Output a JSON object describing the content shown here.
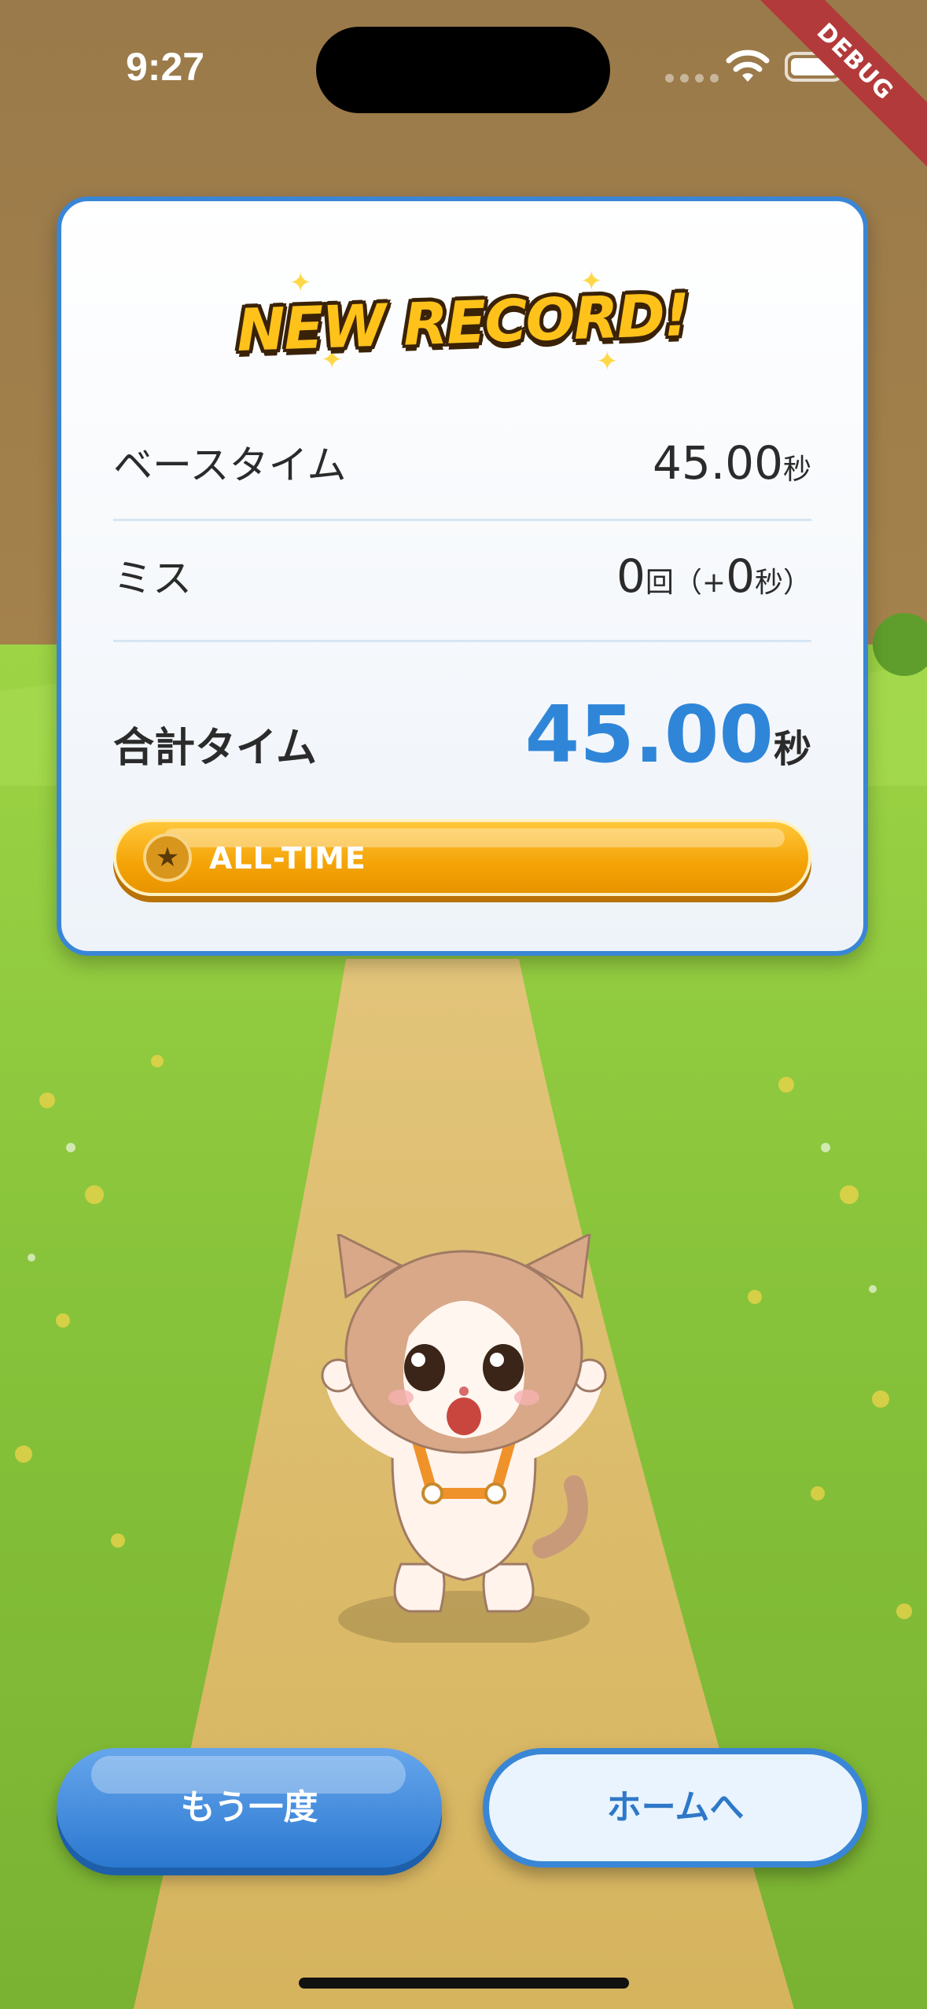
{
  "status_bar": {
    "time": "9:27"
  },
  "debug_banner": "DEBUG",
  "result_card": {
    "badge": "NEW RECORD!",
    "base_time": {
      "label": "ベースタイム",
      "value": "45.00",
      "unit": "秒"
    },
    "miss": {
      "label": "ミス",
      "count": "0",
      "count_unit": "回",
      "penalty_prefix": "（+",
      "penalty_value": "0",
      "penalty_suffix": "秒）"
    },
    "total_time": {
      "label": "合計タイム",
      "value": "45.00",
      "unit": "秒"
    },
    "rank_banner": {
      "label": "ALL-TIME",
      "icon": "star-icon"
    }
  },
  "buttons": {
    "retry": "もう一度",
    "home": "ホームへ"
  },
  "colors": {
    "accent_blue": "#3a86d6",
    "total_blue": "#2f86d8",
    "gold": "#f4a306",
    "debug_red": "#b33a3a"
  }
}
